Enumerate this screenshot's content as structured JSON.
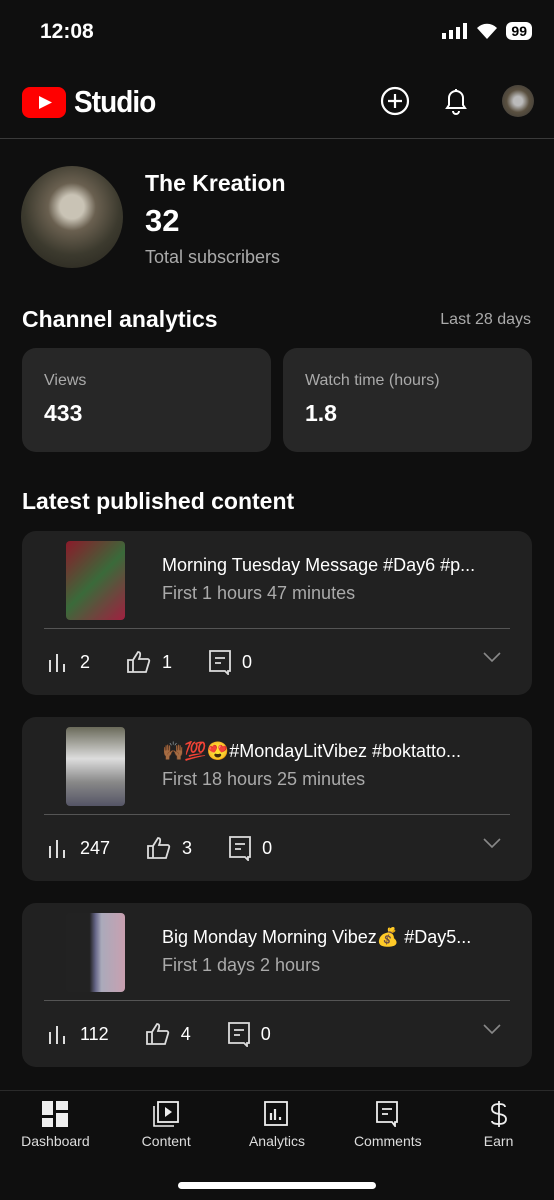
{
  "status": {
    "time": "12:08",
    "battery": "99"
  },
  "header": {
    "logo_text": "Studio"
  },
  "channel": {
    "name": "The Kreation",
    "subscribers": "32",
    "subscribers_label": "Total subscribers"
  },
  "analytics": {
    "title": "Channel analytics",
    "period": "Last 28 days",
    "metrics": [
      {
        "label": "Views",
        "value": "433"
      },
      {
        "label": "Watch time (hours)",
        "value": "1.8"
      }
    ]
  },
  "latest": {
    "title": "Latest published content",
    "items": [
      {
        "title": "Morning Tuesday Message   #Day6 #p...",
        "subtitle": "First 1 hours 47 minutes",
        "views": "2",
        "likes": "1",
        "comments": "0"
      },
      {
        "title": "🙌🏾💯😍#MondayLitVibez  #boktatto...",
        "subtitle": "First 18 hours 25 minutes",
        "views": "247",
        "likes": "3",
        "comments": "0"
      },
      {
        "title": "Big Monday Morning Vibez💰 #Day5...",
        "subtitle": "First 1 days 2 hours",
        "views": "112",
        "likes": "4",
        "comments": "0"
      }
    ]
  },
  "nav": [
    {
      "label": "Dashboard",
      "icon": "dashboard-icon"
    },
    {
      "label": "Content",
      "icon": "content-icon"
    },
    {
      "label": "Analytics",
      "icon": "analytics-icon"
    },
    {
      "label": "Comments",
      "icon": "comments-icon"
    },
    {
      "label": "Earn",
      "icon": "dollar-icon"
    }
  ],
  "colors": {
    "brand": "#ff0000",
    "background": "#0f0f0f",
    "card": "#212121"
  }
}
